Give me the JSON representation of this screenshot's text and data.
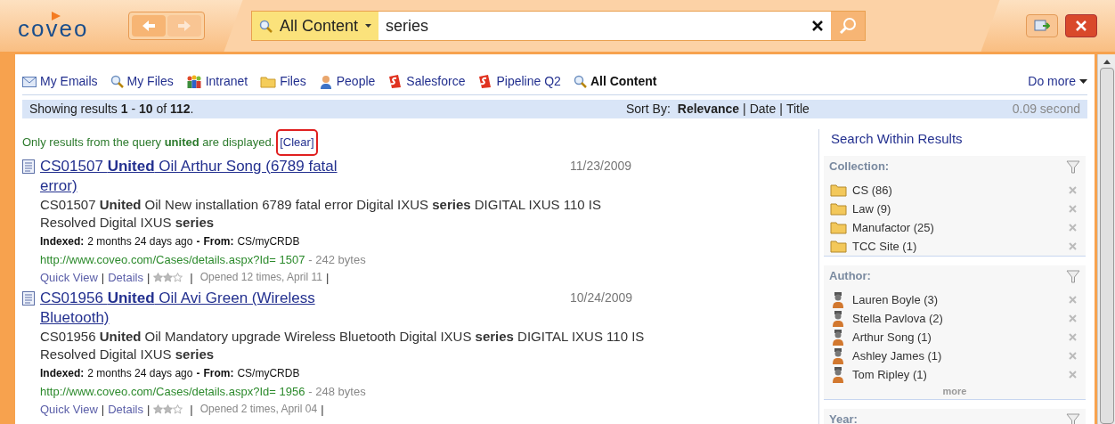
{
  "logo": "coveo",
  "search": {
    "scope": "All Content",
    "value": "series"
  },
  "nav_items": [
    {
      "label": "My Emails",
      "kind": "mail",
      "selected": false
    },
    {
      "label": "My Files",
      "kind": "search",
      "selected": false
    },
    {
      "label": "Intranet",
      "kind": "people",
      "selected": false
    },
    {
      "label": "Files",
      "kind": "folder",
      "selected": false
    },
    {
      "label": "People",
      "kind": "person",
      "selected": false
    },
    {
      "label": "Salesforce",
      "kind": "sf",
      "selected": false
    },
    {
      "label": "Pipeline Q2",
      "kind": "sf",
      "selected": false
    },
    {
      "label": "All Content",
      "kind": "search",
      "selected": true
    }
  ],
  "do_more": "Do more",
  "results_bar": {
    "summary": "Showing results **1** - **10** of **112**.",
    "sort_label": "Sort By:",
    "separator": "|",
    "sort_options": [
      {
        "label": "Relevance",
        "selected": true
      },
      {
        "label": "Date",
        "selected": false
      },
      {
        "label": "Title",
        "selected": false
      }
    ],
    "time": "0.09 second"
  },
  "filter_notice": "Only results from the query **united** are displayed.",
  "clear": "[Clear]",
  "results": [
    {
      "title": "CS01507 **United** Oil Arthur Song (6789 fatal error)",
      "date": "11/23/2009",
      "snippet": "CS01507 **United** Oil New installation 6789 fatal error Digital IXUS **series** DIGITAL IXUS 110 IS Resolved Digital IXUS **series**",
      "indexed_label": "Indexed:",
      "indexed": "2 months 24 days ago",
      "dash": "-",
      "from_label": "From:",
      "from": "CS/myCRDB",
      "url": "http://www.coveo.com/Cases/details.aspx?Id= 1507",
      "size": "- 242 bytes",
      "separator": "|",
      "quick_view": "Quick View",
      "details": "Details",
      "stars": 2,
      "opened": "Opened 12 times, April 11"
    },
    {
      "title": "CS01956 **United** Oil Avi Green (Wireless Bluetooth)",
      "date": "10/24/2009",
      "snippet": "CS01956 **United** Oil Mandatory upgrade Wireless Bluetooth Digital IXUS **series** DIGITAL IXUS 110 IS Resolved Digital IXUS **series**",
      "indexed_label": "Indexed:",
      "indexed": "2 months 24 days ago",
      "dash": "-",
      "from_label": "From:",
      "from": "CS/myCRDB",
      "url": "http://www.coveo.com/Cases/details.aspx?Id= 1956",
      "size": "- 248 bytes",
      "separator": "|",
      "quick_view": "Quick View",
      "details": "Details",
      "stars": 2,
      "opened": "Opened 2 times, April 04"
    }
  ],
  "sidebar": {
    "title": "Search Within Results",
    "facets": [
      {
        "title": "Collection:",
        "kind": "folder",
        "items": [
          "CS (86)",
          "Law (9)",
          "Manufactor (25)",
          "TCC Site (1)"
        ]
      },
      {
        "title": "Author:",
        "kind": "person",
        "items": [
          "Lauren Boyle (3)",
          "Stella Pavlova (2)",
          "Arthur Song (1)",
          "Ashley James (1)",
          "Tom Ripley (1)"
        ],
        "more": "more"
      },
      {
        "title": "Year:"
      }
    ]
  }
}
